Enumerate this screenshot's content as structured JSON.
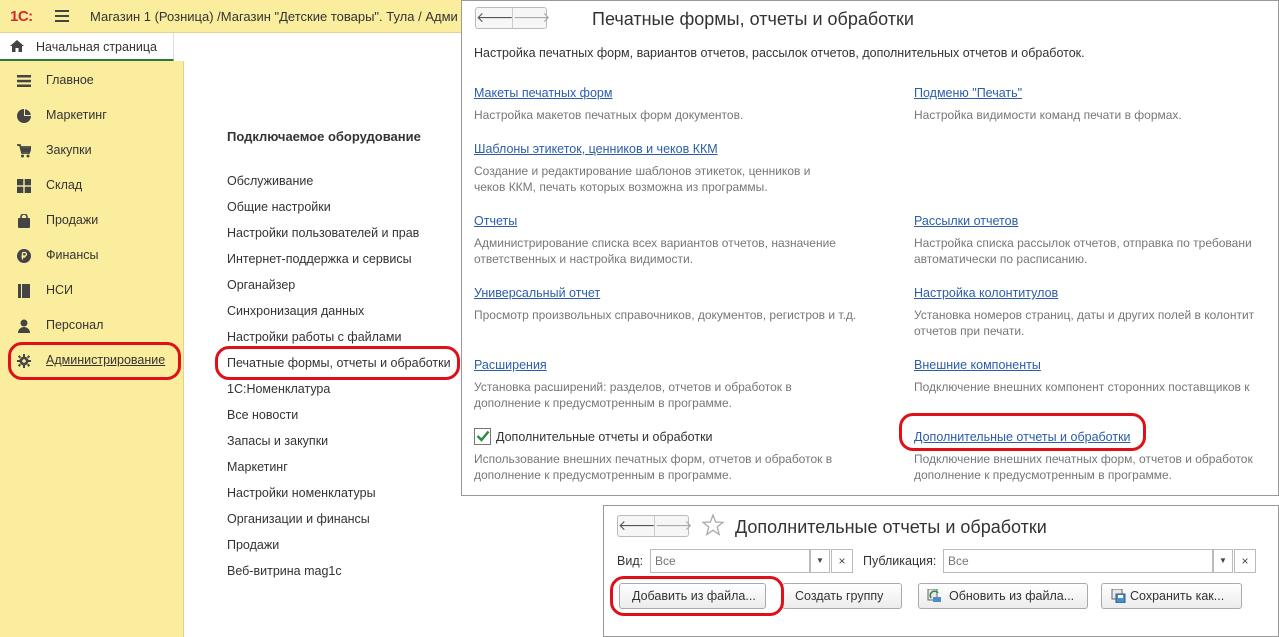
{
  "app": {
    "logo": "1С:",
    "title": "Магазин 1 (Розница) /Магазин \"Детские товары\". Тула / Адми"
  },
  "home_tab": {
    "label": "Начальная страница"
  },
  "sidebar": {
    "items": [
      {
        "label": "Главное",
        "icon": "menu-lines-icon"
      },
      {
        "label": "Маркетинг",
        "icon": "pie-chart-icon"
      },
      {
        "label": "Закупки",
        "icon": "cart-icon"
      },
      {
        "label": "Склад",
        "icon": "warehouse-grid-icon"
      },
      {
        "label": "Продажи",
        "icon": "shopping-bag-icon"
      },
      {
        "label": "Финансы",
        "icon": "ruble-coin-icon"
      },
      {
        "label": "НСИ",
        "icon": "book-icon"
      },
      {
        "label": "Персонал",
        "icon": "person-icon"
      },
      {
        "label": "Администрирование",
        "icon": "gear-icon"
      }
    ]
  },
  "admin": {
    "section_head": "Подключаемое оборудование",
    "links": [
      "Обслуживание",
      "Общие настройки",
      "Настройки пользователей и прав",
      "Интернет-поддержка и сервисы",
      "Органайзер",
      "Синхронизация данных",
      "Настройки работы с файлами",
      "Печатные формы, отчеты и обработки",
      "1С:Номенклатура",
      "Все новости",
      "Запасы и закупки",
      "Маркетинг",
      "Настройки номенклатуры",
      "Организации и финансы",
      "Продажи",
      "Веб-витрина mag1c"
    ]
  },
  "print_forms": {
    "back": "🡐",
    "forward": "🡒",
    "title": "Печатные формы, отчеты и обработки",
    "description": "Настройка печатных форм, вариантов отчетов, рассылок отчетов, дополнительных отчетов и обработок.",
    "left": [
      {
        "link": "Макеты печатных форм",
        "note": [
          "Настройка макетов печатных форм документов."
        ]
      },
      {
        "link": "Шаблоны этикеток, ценников и чеков ККМ",
        "note": [
          "Создание и редактирование шаблонов этикеток, ценников и",
          "чеков ККМ, печать которых возможна из программы."
        ]
      },
      {
        "link": "Отчеты",
        "note": [
          "Администрирование списка всех вариантов отчетов, назначение",
          "ответственных и настройка видимости."
        ]
      },
      {
        "link": "Универсальный отчет",
        "note": [
          "Просмотр произвольных справочников, документов, регистров и т.д."
        ]
      },
      {
        "link": "Расширения",
        "note": [
          "Установка расширений: разделов, отчетов и обработок в",
          "дополнение к предусмотренным в программе."
        ]
      }
    ],
    "right": [
      {
        "link": "Подменю \"Печать\"",
        "note": [
          "Настройка видимости команд печати в формах."
        ]
      },
      {
        "link": "Рассылки отчетов",
        "note": [
          "Настройка списка рассылок отчетов, отправка по требовани",
          "автоматически по расписанию."
        ]
      },
      {
        "link": "Настройка колонтитулов",
        "note": [
          "Установка номеров страниц, даты и других полей в колонтит",
          "отчетов при печати."
        ]
      },
      {
        "link": "Внешние компоненты",
        "note": [
          "Подключение внешних компонент сторонних поставщиков к"
        ]
      },
      {
        "link": "Дополнительные отчеты и обработки",
        "note": [
          "Подключение внешних печатных форм, отчетов и обработок",
          "дополнение к предусмотренным в программе."
        ]
      }
    ],
    "checkbox": {
      "checked": true,
      "label": "Дополнительные отчеты и обработки",
      "note": [
        "Использование внешних печатных форм, отчетов и обработок в",
        "дополнение к предусмотренным в программе."
      ]
    }
  },
  "additional_reports": {
    "back": "🡐",
    "forward": "🡒",
    "title": "Дополнительные отчеты и обработки",
    "filters": {
      "kind_label": "Вид:",
      "kind_placeholder": "Все",
      "publication_label": "Публикация:",
      "publication_placeholder": "Все",
      "dropdown": "▼",
      "clear": "×"
    },
    "buttons": {
      "add_from_file": "Добавить из файла...",
      "create_group": "Создать группу",
      "update_from_file": "Обновить из файла...",
      "save_as": "Сохранить как..."
    }
  },
  "colors": {
    "sidebar_bg": "#fbed9e",
    "link": "#2b5daa",
    "highlight": "#e0101a",
    "check": "#2b8a3e"
  }
}
